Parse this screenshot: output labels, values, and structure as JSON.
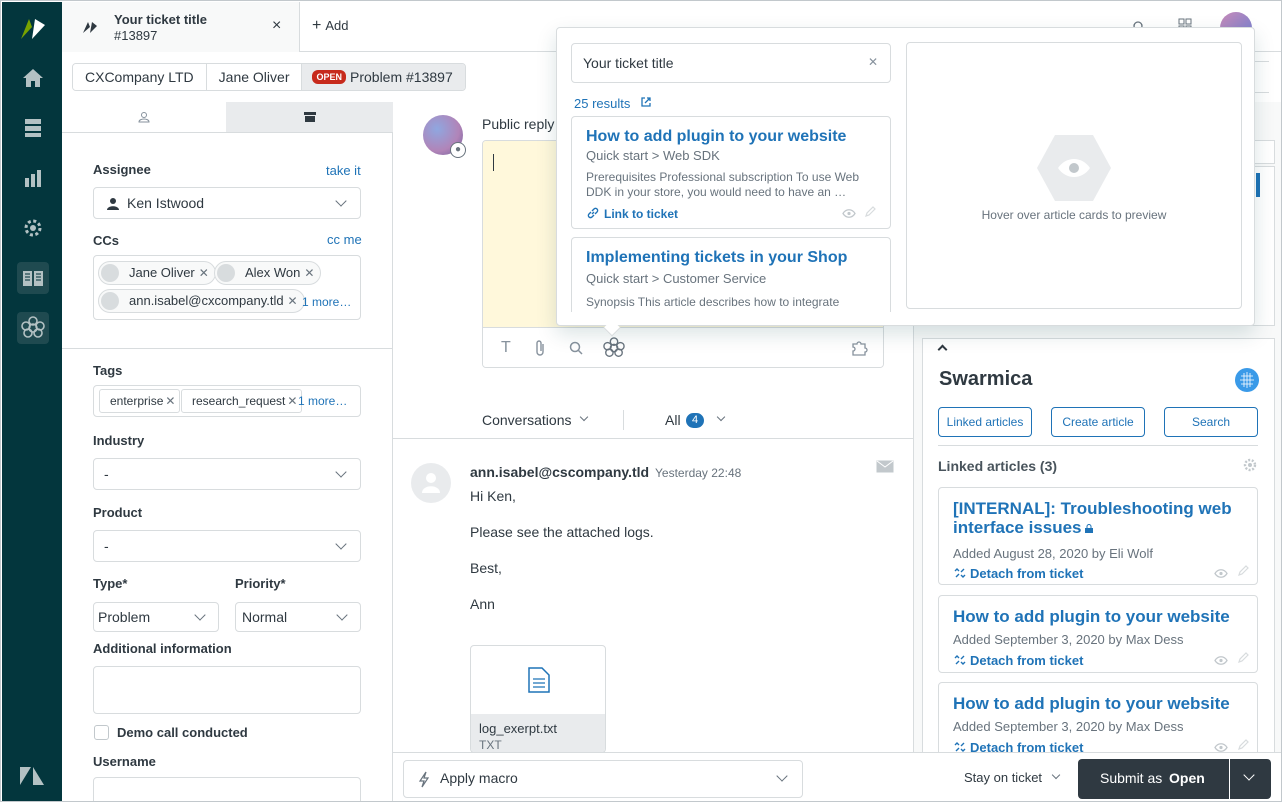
{
  "tab": {
    "title": "Your ticket title",
    "subtitle": "#13897",
    "close": "×"
  },
  "add_label": "Add",
  "breadcrumb": {
    "org": "CXCompany LTD",
    "requester": "Jane Oliver",
    "status_badge": "OPEN",
    "ticket": "Problem #13897"
  },
  "left": {
    "assignee_label": "Assignee",
    "take_it": "take it",
    "assignee_value": "Ken Istwood",
    "ccs_label": "CCs",
    "cc_me": "cc me",
    "ccs": [
      "Jane Oliver",
      "Alex Won",
      "ann.isabel@cxcompany.tld"
    ],
    "ccs_more": "1 more…",
    "tags_label": "Tags",
    "tags": [
      "enterprise",
      "research_request"
    ],
    "tags_more": "1 more…",
    "industry_label": "Industry",
    "industry_value": "-",
    "product_label": "Product",
    "product_value": "-",
    "type_label": "Type*",
    "type_value": "Problem",
    "priority_label": "Priority*",
    "priority_value": "Normal",
    "additional_label": "Additional information",
    "demo_label": "Demo call conducted",
    "username_label": "Username"
  },
  "composer": {
    "public_reply": "Public reply"
  },
  "conv": {
    "filter": "Conversations",
    "all": "All",
    "count": "4"
  },
  "message": {
    "author": "ann.isabel@cscompany.tld",
    "time": "Yesterday 22:48",
    "lines": [
      "Hi Ken,",
      "Please see the attached logs.",
      "Best,",
      "Ann"
    ],
    "attachment_name": "log_exerpt.txt",
    "attachment_type": "TXT"
  },
  "bottom": {
    "macro": "Apply macro",
    "stay": "Stay on ticket",
    "submit_prefix": "Submit as",
    "submit_status": "Open"
  },
  "app": {
    "name": "Swarmica",
    "buttons": [
      "Linked articles",
      "Create article",
      "Search"
    ],
    "linked_title": "Linked articles (3)",
    "cards": [
      {
        "title": "[INTERNAL]: Troubleshooting web interface issues",
        "meta": "Added August 28, 2020 by Eli Wolf",
        "action": "Detach from ticket"
      },
      {
        "title": "How to add plugin to your website",
        "meta": "Added September 3, 2020 by Max Dess",
        "action": "Detach from ticket"
      },
      {
        "title": "How to add plugin to your website",
        "meta": "Added September 3, 2020 by Max Dess",
        "action": "Detach from ticket"
      }
    ]
  },
  "popover": {
    "search_value": "Your ticket title",
    "results": "25 results",
    "results_list": [
      {
        "title": "How to add plugin to your website",
        "path": "Quick start > Web SDK",
        "excerpt": "Prerequisites Professional subscription To use Web DDK in your store, you would need to have an …",
        "action": "Link to ticket"
      },
      {
        "title": "Implementing tickets in your Shop",
        "path": "Quick start > Customer Service",
        "excerpt": "Synopsis This article describes how to integrate"
      }
    ],
    "preview_hint": "Hover over article cards to preview"
  },
  "colors": {
    "rail": "#03363d",
    "link": "#1f73b7",
    "badge": "#c72a1c",
    "submit": "#2f3941"
  }
}
